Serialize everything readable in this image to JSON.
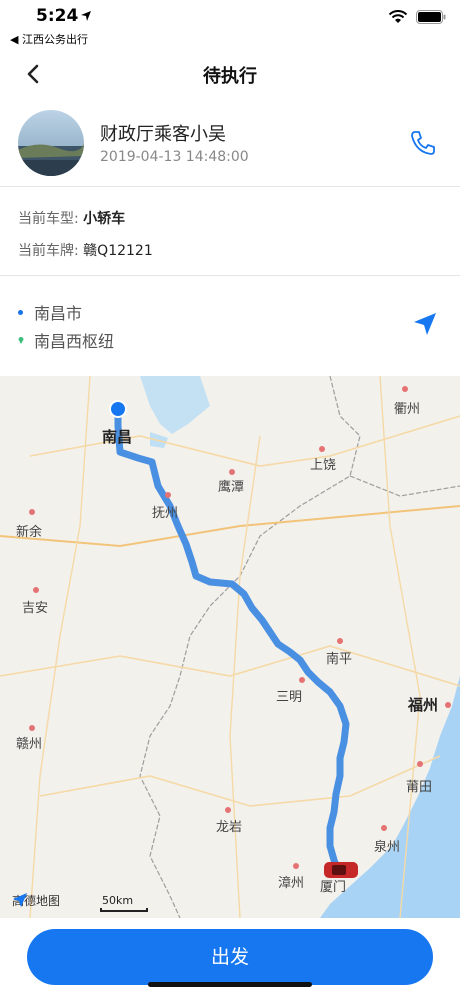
{
  "status_bar": {
    "time": "5:24",
    "back_app": "◀ 江西公务出行"
  },
  "nav": {
    "title": "待执行"
  },
  "passenger": {
    "name": "财政厅乘客小吴",
    "time": "2019-04-13 14:48:00"
  },
  "car": {
    "type_label": "当前车型:",
    "type_value": "小轿车",
    "plate_label": "当前车牌:",
    "plate_value": "赣Q12121"
  },
  "route": {
    "origin": "南昌市",
    "destination": "南昌西枢纽"
  },
  "map": {
    "cities": {
      "nanchang": "南昌",
      "quzhou": "衢州",
      "shangrao": "上饶",
      "yingtan": "鹰潭",
      "fuzhou_jx": "抚州",
      "xinyu": "新余",
      "jian": "吉安",
      "nanping": "南平",
      "sanming": "三明",
      "fuzhou": "福州",
      "ganzhou": "赣州",
      "putian": "莆田",
      "quanzhou": "泉州",
      "longyan": "龙岩",
      "zhangzhou": "漳州",
      "xiamen": "厦门"
    },
    "logo": "高德地图",
    "scale": "50km",
    "route_color": "#4a90e2"
  },
  "bottom": {
    "go_label": "出发"
  },
  "colors": {
    "accent": "#1677f0",
    "route": "#4a90e2"
  }
}
